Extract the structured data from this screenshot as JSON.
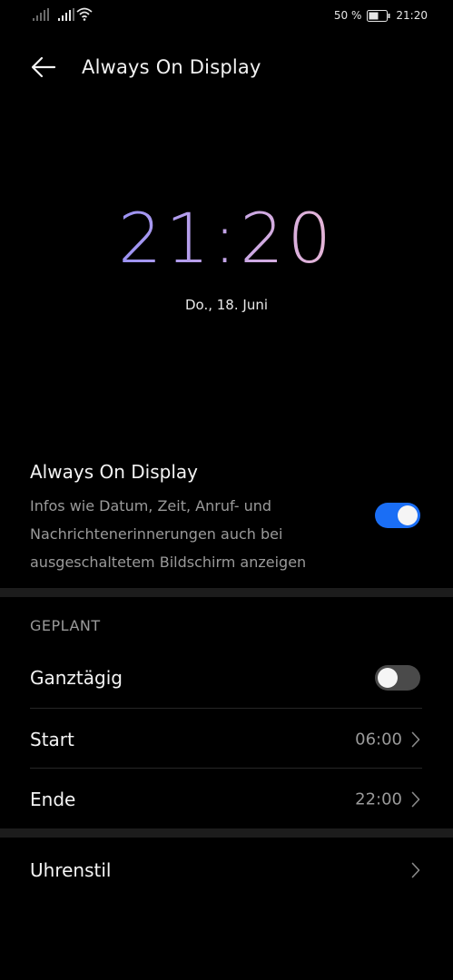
{
  "status_bar": {
    "battery_percent": "50 %",
    "time": "21:20",
    "icons": [
      "signal-icon",
      "signal-icon",
      "wifi-icon",
      "battery-icon"
    ]
  },
  "header": {
    "title": "Always On Display",
    "back_icon": "arrow-left-icon"
  },
  "preview": {
    "time": "21:20",
    "date": "Do., 18. Juni"
  },
  "aod": {
    "title": "Always On Display",
    "description": "Infos wie Datum, Zeit, Anruf- und Nachrichtenerinnerungen auch bei ausgeschaltetem Bildschirm anzeigen",
    "enabled": true
  },
  "scheduled": {
    "header": "GEPLANT",
    "all_day": {
      "label": "Ganztägig",
      "enabled": false
    },
    "start": {
      "label": "Start",
      "value": "06:00"
    },
    "end": {
      "label": "Ende",
      "value": "22:00"
    }
  },
  "clock_style": {
    "label": "Uhrenstil"
  },
  "colors": {
    "accent": "#1a6ef5",
    "background": "#000000",
    "secondary_text": "#9a9a9a",
    "clock_gradient_start": "#9a92f4",
    "clock_gradient_end": "#e7b6d6"
  }
}
